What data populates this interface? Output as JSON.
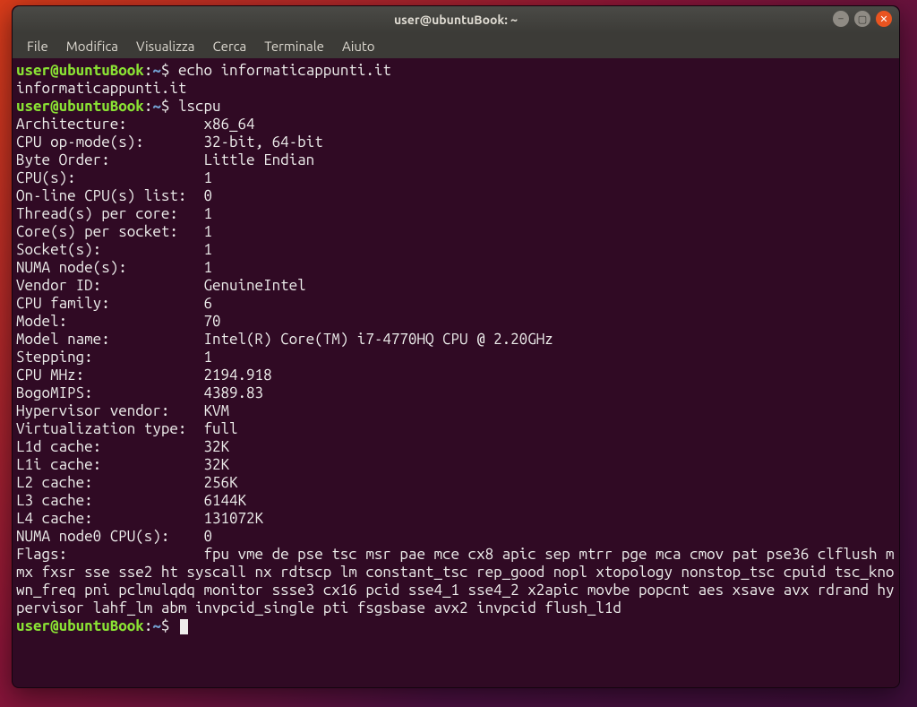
{
  "titlebar": {
    "title": "user@ubuntuBook: ~"
  },
  "menubar": {
    "items": [
      "File",
      "Modifica",
      "Visualizza",
      "Cerca",
      "Terminale",
      "Aiuto"
    ]
  },
  "prompt": {
    "userhost": "user@ubuntuBook",
    "sep": ":",
    "path": "~",
    "dollar": "$"
  },
  "lines": {
    "cmd1": "echo informaticappunti.it",
    "out1": "informaticappunti.it",
    "cmd2": "lscpu"
  },
  "lscpu_fields": [
    {
      "label": "Architecture:",
      "value": "x86_64"
    },
    {
      "label": "CPU op-mode(s):",
      "value": "32-bit, 64-bit"
    },
    {
      "label": "Byte Order:",
      "value": "Little Endian"
    },
    {
      "label": "CPU(s):",
      "value": "1"
    },
    {
      "label": "On-line CPU(s) list:",
      "value": "0"
    },
    {
      "label": "Thread(s) per core:",
      "value": "1"
    },
    {
      "label": "Core(s) per socket:",
      "value": "1"
    },
    {
      "label": "Socket(s):",
      "value": "1"
    },
    {
      "label": "NUMA node(s):",
      "value": "1"
    },
    {
      "label": "Vendor ID:",
      "value": "GenuineIntel"
    },
    {
      "label": "CPU family:",
      "value": "6"
    },
    {
      "label": "Model:",
      "value": "70"
    },
    {
      "label": "Model name:",
      "value": "Intel(R) Core(TM) i7-4770HQ CPU @ 2.20GHz"
    },
    {
      "label": "Stepping:",
      "value": "1"
    },
    {
      "label": "CPU MHz:",
      "value": "2194.918"
    },
    {
      "label": "BogoMIPS:",
      "value": "4389.83"
    },
    {
      "label": "Hypervisor vendor:",
      "value": "KVM"
    },
    {
      "label": "Virtualization type:",
      "value": "full"
    },
    {
      "label": "L1d cache:",
      "value": "32K"
    },
    {
      "label": "L1i cache:",
      "value": "32K"
    },
    {
      "label": "L2 cache:",
      "value": "256K"
    },
    {
      "label": "L3 cache:",
      "value": "6144K"
    },
    {
      "label": "L4 cache:",
      "value": "131072K"
    },
    {
      "label": "NUMA node0 CPU(s):",
      "value": "0"
    }
  ],
  "flags": {
    "label": "Flags:",
    "value": "fpu vme de pse tsc msr pae mce cx8 apic sep mtrr pge mca cmov pat pse36 clflush mmx fxsr sse sse2 ht syscall nx rdtscp lm constant_tsc rep_good nopl xtopology nonstop_tsc cpuid tsc_known_freq pni pclmulqdq monitor ssse3 cx16 pcid sse4_1 sse4_2 x2apic movbe popcnt aes xsave avx rdrand hypervisor lahf_lm abm invpcid_single pti fsgsbase avx2 invpcid flush_l1d"
  },
  "label_col_width": 21
}
